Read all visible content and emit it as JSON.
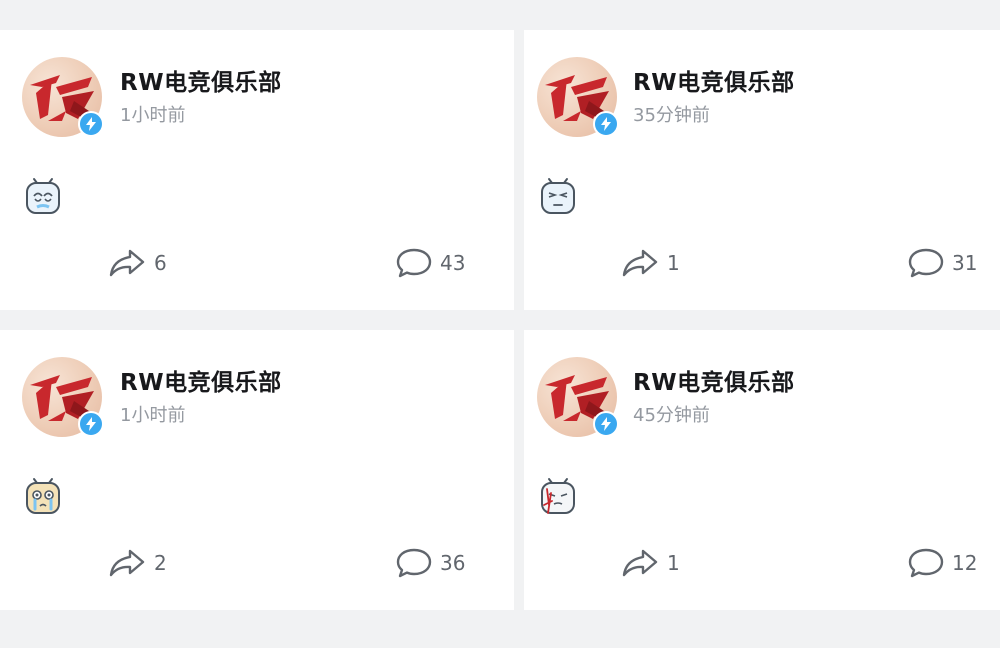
{
  "feed": {
    "posts": [
      {
        "author": "RW电竞俱乐部",
        "time": "1小时前",
        "emoji_icon": "sweat-cry-emoji-icon",
        "shares": "6",
        "comments": "43"
      },
      {
        "author": "RW电竞俱乐部",
        "time": "35分钟前",
        "emoji_icon": "speechless-emoji-icon",
        "shares": "1",
        "comments": "31"
      },
      {
        "author": "RW电竞俱乐部",
        "time": "1小时前",
        "emoji_icon": "crying-emoji-icon",
        "shares": "2",
        "comments": "36"
      },
      {
        "author": "RW电竞俱乐部",
        "time": "45分钟前",
        "emoji_icon": "bleeding-emoji-icon",
        "shares": "1",
        "comments": "12"
      }
    ]
  },
  "colors": {
    "page_bg": "#f1f2f3",
    "card_bg": "#ffffff",
    "name": "#18191c",
    "meta": "#9499a0",
    "action": "#61666d",
    "badge": "#3aa8f0",
    "logo_red": "#c8282d"
  }
}
